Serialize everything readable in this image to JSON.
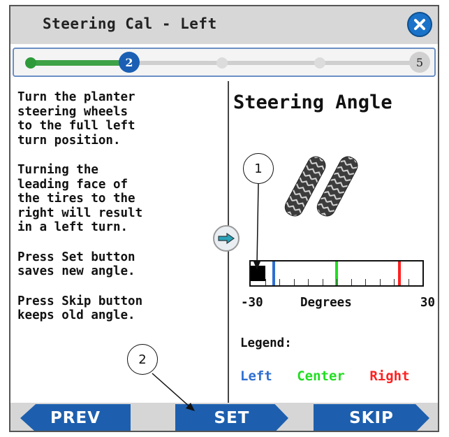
{
  "window": {
    "title": "Steering Cal - Left",
    "close_icon": "close-icon"
  },
  "progress": {
    "current_step": "2",
    "total_steps": "5"
  },
  "instructions": [
    "Turn the planter\nsteering wheels\nto the full left\nturn position.",
    "Turning the\nleading face of\nthe tires to the\nright will result\nin a left turn.",
    "Press Set button\nsaves new angle.",
    "Press Skip button\nkeeps old angle."
  ],
  "steering": {
    "title": "Steering Angle",
    "gauge_min_label": "-30",
    "gauge_max_label": "30",
    "gauge_unit_label": "Degrees",
    "current_angle": -25,
    "range": [
      -30,
      30
    ],
    "left_marker": -22,
    "center_marker": 0,
    "right_marker": 22,
    "legend_title": "Legend:",
    "legend": {
      "left": "Left",
      "center": "Center",
      "right": "Right"
    },
    "colors": {
      "left": "#2f6fd0",
      "center": "#22dd22",
      "right": "#ff2020"
    }
  },
  "buttons": {
    "prev": "PREV",
    "set": "SET",
    "skip": "SKIP"
  },
  "callouts": {
    "one": "1",
    "two": "2"
  }
}
